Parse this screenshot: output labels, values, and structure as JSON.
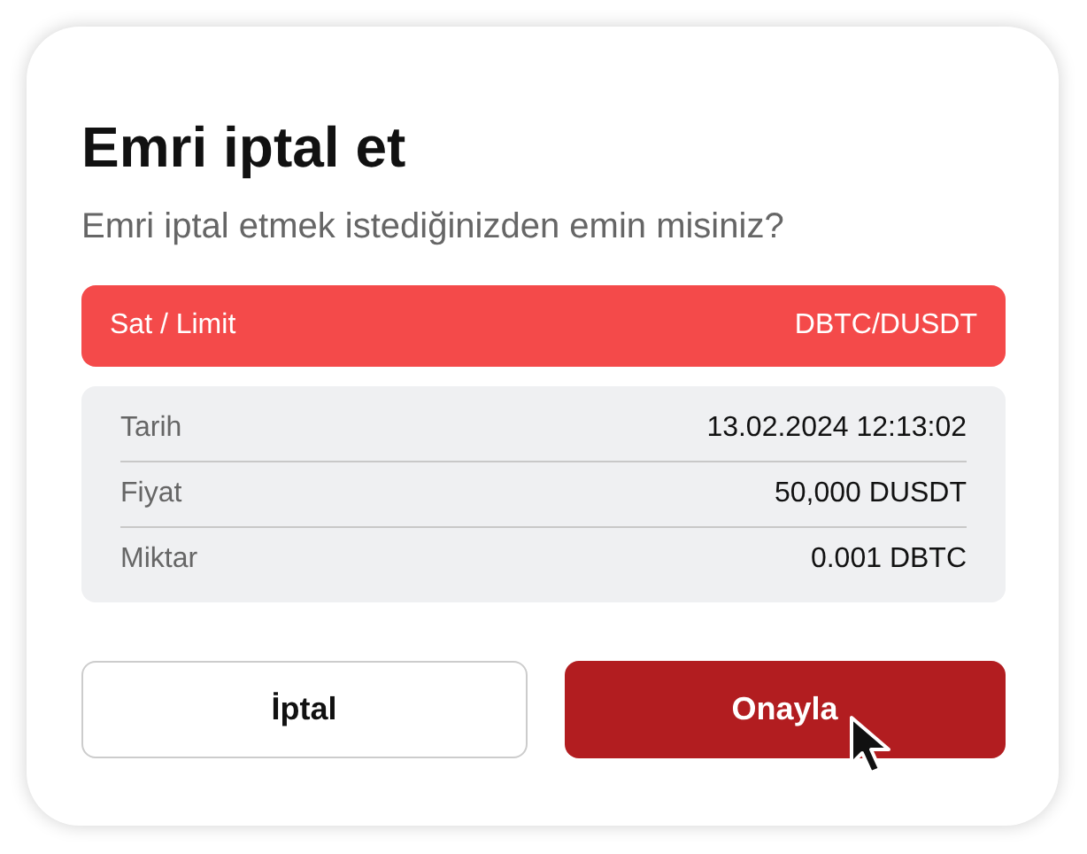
{
  "dialog": {
    "title": "Emri iptal et",
    "message": "Emri iptal etmek istediğinizden emin misiniz?",
    "order_bar": {
      "side": "Sat / Limit",
      "pair": "DBTC/DUSDT"
    },
    "details": [
      {
        "label": "Tarih",
        "value": "13.02.2024 12:13:02"
      },
      {
        "label": "Fiyat",
        "value": "50,000 DUSDT"
      },
      {
        "label": "Miktar",
        "value": "0.001 DBTC"
      }
    ],
    "buttons": [
      {
        "label": "İptal",
        "kind": "secondary"
      },
      {
        "label": "Onayla",
        "kind": "primary"
      }
    ]
  }
}
